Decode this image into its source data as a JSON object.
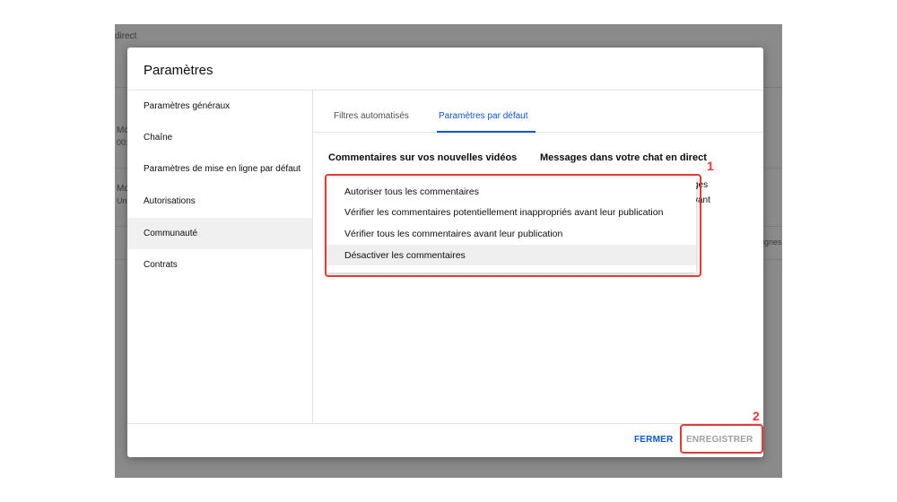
{
  "background": {
    "top_text": "direct",
    "left_fragments": [
      "Mc",
      "00:",
      "Mc",
      "Un"
    ],
    "right_fragments": [
      "ges",
      "vant",
      "ignes"
    ]
  },
  "dialog": {
    "title": "Paramètres",
    "sidebar": {
      "items": [
        {
          "label": "Paramètres généraux"
        },
        {
          "label": "Chaîne"
        },
        {
          "label": "Paramètres de mise en ligne par défaut"
        },
        {
          "label": "Autorisations"
        },
        {
          "label": "Communauté"
        },
        {
          "label": "Contrats"
        }
      ],
      "active_index": 4
    },
    "tabs": [
      {
        "label": "Filtres automatisés"
      },
      {
        "label": "Paramètres par défaut"
      }
    ],
    "active_tab": 1,
    "columns": {
      "comments_heading": "Commentaires sur vos nouvelles vidéos",
      "chat_heading": "Messages dans votre chat en direct"
    },
    "dropdown": {
      "options": [
        {
          "label": "Autoriser tous les commentaires"
        },
        {
          "label": "Vérifier les commentaires potentiellement inappropriés avant leur publication"
        },
        {
          "label": "Vérifier tous les commentaires avant leur publication"
        },
        {
          "label": "Désactiver les commentaires"
        }
      ],
      "hovered_index": 3
    },
    "footer": {
      "close_label": "FERMER",
      "save_label": "ENREGISTRER"
    }
  },
  "annotations": {
    "marker_1": "1",
    "marker_2": "2",
    "color": "#e53935"
  },
  "colors": {
    "accent": "#0b57d0",
    "disabled": "#9e9e9e",
    "overlay": "#8a8a8a"
  }
}
